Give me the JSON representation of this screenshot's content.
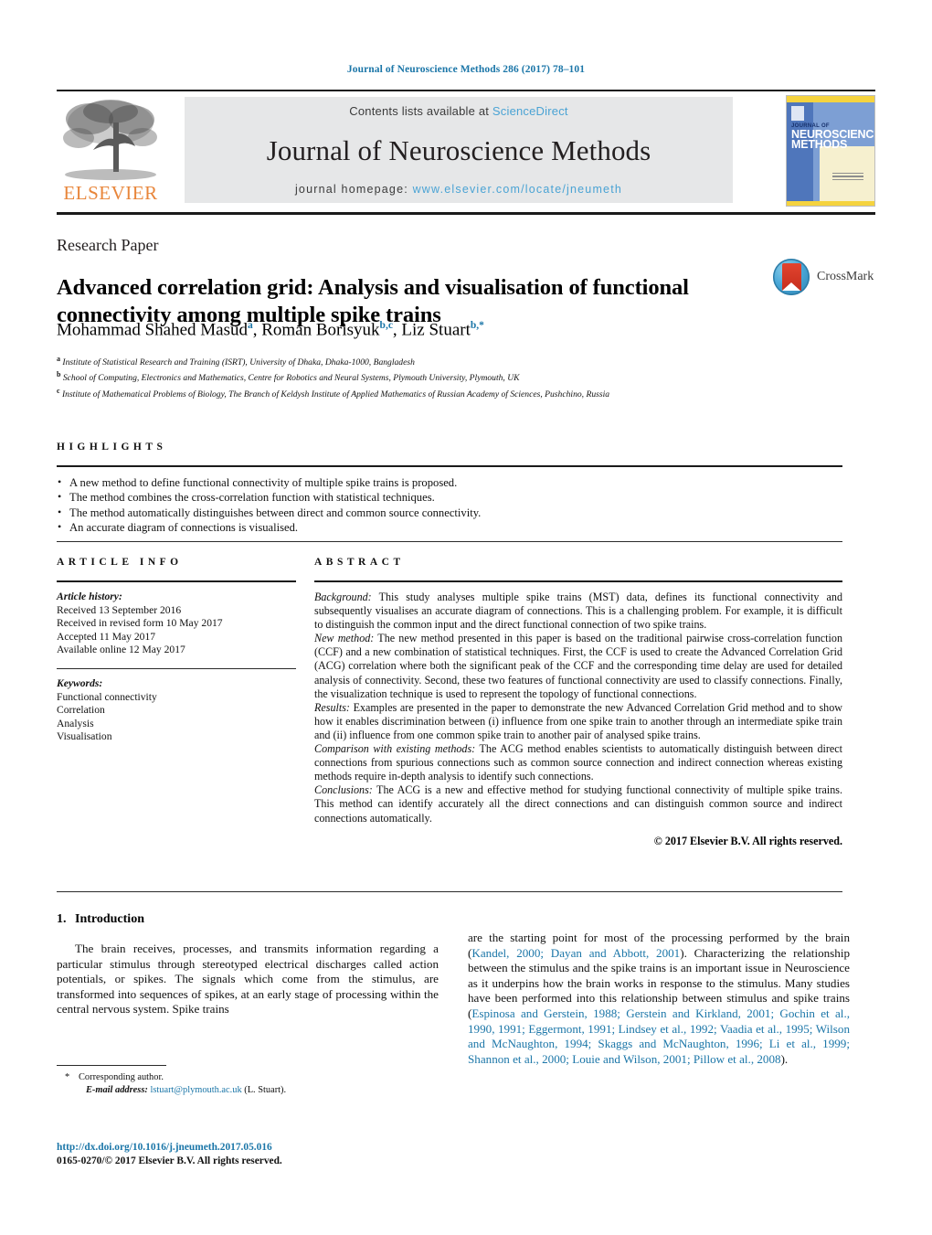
{
  "running_header": "Journal of Neuroscience Methods 286 (2017) 78–101",
  "masthead": {
    "publisher_name": "ELSEVIER",
    "publisher_logo_icon": "elsevier-tree-icon",
    "contents_prefix": "Contents lists available at ",
    "contents_link": "ScienceDirect",
    "journal_title": "Journal of Neuroscience Methods",
    "homepage_prefix": "journal homepage: ",
    "homepage_url": "www.elsevier.com/locate/jneumeth",
    "cover": {
      "line1": "JOURNAL OF",
      "line2": "NEUROSCIENCE",
      "line3": "METHODS"
    }
  },
  "article": {
    "type": "Research Paper",
    "title": "Advanced correlation grid: Analysis and visualisation of functional connectivity among multiple spike trains",
    "crossmark_label": "CrossMark",
    "authors_html": "Mohammad Shahed Masud<sup>a</sup>, Roman Borisyuk<sup>b,c</sup>, Liz Stuart<sup>b,</sup><sup>*</sup>",
    "affiliations": [
      {
        "mark": "a",
        "text": "Institute of Statistical Research and Training (ISRT), University of Dhaka, Dhaka-1000, Bangladesh"
      },
      {
        "mark": "b",
        "text": "School of Computing, Electronics and Mathematics, Centre for Robotics and Neural Systems, Plymouth University, Plymouth, UK"
      },
      {
        "mark": "c",
        "text": "Institute of Mathematical Problems of Biology, The Branch of Keldysh Institute of Applied Mathematics of Russian Academy of Sciences, Pushchino, Russia"
      }
    ]
  },
  "highlights": {
    "label": "HIGHLIGHTS",
    "items": [
      "A new method to define functional connectivity of multiple spike trains is proposed.",
      "The method combines the cross-correlation function with statistical techniques.",
      "The method automatically distinguishes between direct and common source connectivity.",
      "An accurate diagram of connections is visualised."
    ]
  },
  "article_info": {
    "label": "ARTICLE INFO",
    "history_heading": "Article history:",
    "history": [
      "Received 13 September 2016",
      "Received in revised form 10 May 2017",
      "Accepted 11 May 2017",
      "Available online 12 May 2017"
    ],
    "keywords_heading": "Keywords:",
    "keywords": [
      "Functional connectivity",
      "Correlation",
      "Analysis",
      "Visualisation"
    ]
  },
  "abstract": {
    "label": "ABSTRACT",
    "sections": [
      {
        "lead": "Background:",
        "text": " This study analyses multiple spike trains (MST) data, defines its functional connectivity and subsequently visualises an accurate diagram of connections. This is a challenging problem. For example, it is difficult to distinguish the common input and the direct functional connection of two spike trains."
      },
      {
        "lead": "New method:",
        "text": " The new method presented in this paper is based on the traditional pairwise cross-correlation function (CCF) and a new combination of statistical techniques. First, the CCF is used to create the Advanced Correlation Grid (ACG) correlation where both the significant peak of the CCF and the corresponding time delay are used for detailed analysis of connectivity. Second, these two features of functional connectivity are used to classify connections. Finally, the visualization technique is used to represent the topology of functional connections."
      },
      {
        "lead": "Results:",
        "text": " Examples are presented in the paper to demonstrate the new Advanced Correlation Grid method and to show how it enables discrimination between (i) influence from one spike train to another through an intermediate spike train and (ii) influence from one common spike train to another pair of analysed spike trains."
      },
      {
        "lead": "Comparison with existing methods:",
        "text": " The ACG method enables scientists to automatically distinguish between direct connections from spurious connections such as common source connection and indirect connection whereas existing methods require in-depth analysis to identify such connections."
      },
      {
        "lead": "Conclusions:",
        "text": " The ACG is a new and effective method for studying functional connectivity of multiple spike trains. This method can identify accurately all the direct connections and can distinguish common source and indirect connections automatically."
      }
    ],
    "copyright": "© 2017 Elsevier B.V. All rights reserved."
  },
  "body": {
    "section_number": "1.",
    "section_title": "Introduction",
    "left_paragraph": "The brain receives, processes, and transmits information regarding a particular stimulus through stereotyped electrical discharges called action potentials, or spikes. The signals which come from the stimulus, are transformed into sequences of spikes, at an early stage of processing within the central nervous system. Spike trains",
    "right_paragraph_parts": [
      {
        "type": "text",
        "value": "are the starting point for most of the processing performed by the brain ("
      },
      {
        "type": "link",
        "value": "Kandel, 2000; Dayan and Abbott, 2001"
      },
      {
        "type": "text",
        "value": "). Characterizing the relationship between the stimulus and the spike trains is an important issue in Neuroscience as it underpins how the brain works in response to the stimulus. Many studies have been performed into this relationship between stimulus and spike trains ("
      },
      {
        "type": "link",
        "value": "Espinosa and Gerstein, 1988; Gerstein and Kirkland, 2001; Gochin et al., 1990, 1991; Eggermont, 1991; Lindsey et al., 1992; Vaadia et al., 1995; Wilson and McNaughton, 1994; Skaggs and McNaughton, 1996; Li et al., 1999; Shannon et al., 2000; Louie and Wilson, 2001; Pillow et al., 2008"
      },
      {
        "type": "text",
        "value": ")."
      }
    ]
  },
  "footer": {
    "corresponding_author": "Corresponding author.",
    "email_label": "E-mail address:",
    "email": "lstuart@plymouth.ac.uk",
    "email_suffix": " (L. Stuart).",
    "doi_url": "http://dx.doi.org/10.1016/j.jneumeth.2017.05.016",
    "issn_line": "0165-0270/© 2017 Elsevier B.V. All rights reserved."
  },
  "colors": {
    "link_blue": "#1b76a8",
    "light_blue": "#4aa3d4",
    "elsevier_orange": "#E8863B",
    "band_gray": "#e6e7e8"
  }
}
